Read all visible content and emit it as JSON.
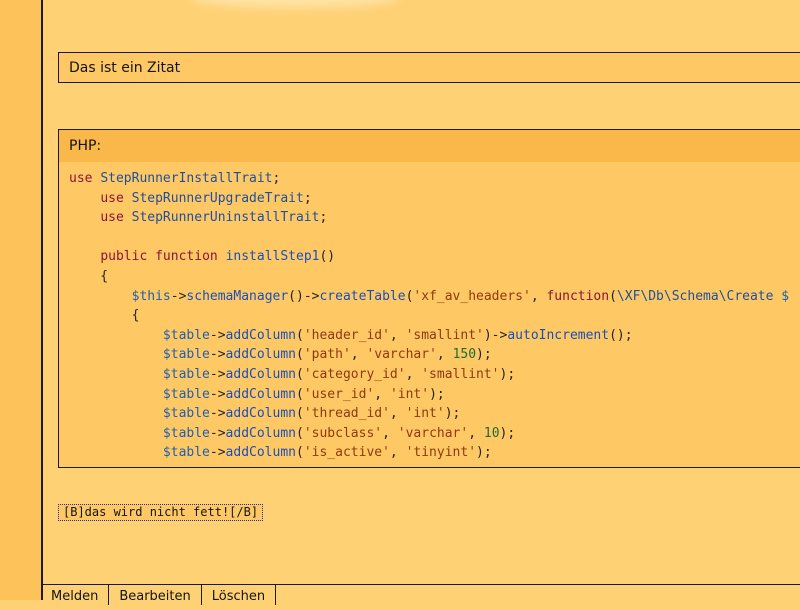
{
  "quote": {
    "text": "Das ist ein Zitat"
  },
  "code": {
    "header": "PHP:",
    "lines": [
      [
        [
          "kw",
          "use"
        ],
        [
          "t",
          " "
        ],
        [
          "cls",
          "StepRunnerInstallTrait"
        ],
        [
          "t",
          ";"
        ]
      ],
      [
        [
          "t",
          "    "
        ],
        [
          "kw",
          "use"
        ],
        [
          "t",
          " "
        ],
        [
          "cls",
          "StepRunnerUpgradeTrait"
        ],
        [
          "t",
          ";"
        ]
      ],
      [
        [
          "t",
          "    "
        ],
        [
          "kw",
          "use"
        ],
        [
          "t",
          " "
        ],
        [
          "cls",
          "StepRunnerUninstallTrait"
        ],
        [
          "t",
          ";"
        ]
      ],
      [],
      [
        [
          "t",
          "    "
        ],
        [
          "kw",
          "public"
        ],
        [
          "t",
          " "
        ],
        [
          "kw",
          "function"
        ],
        [
          "t",
          " "
        ],
        [
          "fn",
          "installStep1"
        ],
        [
          "t",
          "()"
        ]
      ],
      [
        [
          "t",
          "    {"
        ]
      ],
      [
        [
          "t",
          "        "
        ],
        [
          "var",
          "$this"
        ],
        [
          "t",
          "->"
        ],
        [
          "fn",
          "schemaManager"
        ],
        [
          "t",
          "()->"
        ],
        [
          "fn",
          "createTable"
        ],
        [
          "t",
          "("
        ],
        [
          "str",
          "'xf_av_headers'"
        ],
        [
          "t",
          ", "
        ],
        [
          "kw",
          "function"
        ],
        [
          "t",
          "("
        ],
        [
          "cls",
          "\\XF\\Db\\Schema\\Create"
        ],
        [
          "t",
          " "
        ],
        [
          "var",
          "$"
        ]
      ],
      [
        [
          "t",
          "        {"
        ]
      ],
      [
        [
          "t",
          "            "
        ],
        [
          "var",
          "$table"
        ],
        [
          "t",
          "->"
        ],
        [
          "fn",
          "addColumn"
        ],
        [
          "t",
          "("
        ],
        [
          "str",
          "'header_id'"
        ],
        [
          "t",
          ", "
        ],
        [
          "str",
          "'smallint'"
        ],
        [
          "t",
          ")->"
        ],
        [
          "fn",
          "autoIncrement"
        ],
        [
          "t",
          "();"
        ]
      ],
      [
        [
          "t",
          "            "
        ],
        [
          "var",
          "$table"
        ],
        [
          "t",
          "->"
        ],
        [
          "fn",
          "addColumn"
        ],
        [
          "t",
          "("
        ],
        [
          "str",
          "'path'"
        ],
        [
          "t",
          ", "
        ],
        [
          "str",
          "'varchar'"
        ],
        [
          "t",
          ", "
        ],
        [
          "num",
          "150"
        ],
        [
          "t",
          ");"
        ]
      ],
      [
        [
          "t",
          "            "
        ],
        [
          "var",
          "$table"
        ],
        [
          "t",
          "->"
        ],
        [
          "fn",
          "addColumn"
        ],
        [
          "t",
          "("
        ],
        [
          "str",
          "'category_id'"
        ],
        [
          "t",
          ", "
        ],
        [
          "str",
          "'smallint'"
        ],
        [
          "t",
          ");"
        ]
      ],
      [
        [
          "t",
          "            "
        ],
        [
          "var",
          "$table"
        ],
        [
          "t",
          "->"
        ],
        [
          "fn",
          "addColumn"
        ],
        [
          "t",
          "("
        ],
        [
          "str",
          "'user_id'"
        ],
        [
          "t",
          ", "
        ],
        [
          "str",
          "'int'"
        ],
        [
          "t",
          ");"
        ]
      ],
      [
        [
          "t",
          "            "
        ],
        [
          "var",
          "$table"
        ],
        [
          "t",
          "->"
        ],
        [
          "fn",
          "addColumn"
        ],
        [
          "t",
          "("
        ],
        [
          "str",
          "'thread_id'"
        ],
        [
          "t",
          ", "
        ],
        [
          "str",
          "'int'"
        ],
        [
          "t",
          ");"
        ]
      ],
      [
        [
          "t",
          "            "
        ],
        [
          "var",
          "$table"
        ],
        [
          "t",
          "->"
        ],
        [
          "fn",
          "addColumn"
        ],
        [
          "t",
          "("
        ],
        [
          "str",
          "'subclass'"
        ],
        [
          "t",
          ", "
        ],
        [
          "str",
          "'varchar'"
        ],
        [
          "t",
          ", "
        ],
        [
          "num",
          "10"
        ],
        [
          "t",
          ");"
        ]
      ],
      [
        [
          "t",
          "            "
        ],
        [
          "var",
          "$table"
        ],
        [
          "t",
          "->"
        ],
        [
          "fn",
          "addColumn"
        ],
        [
          "t",
          "("
        ],
        [
          "str",
          "'is_active'"
        ],
        [
          "t",
          ", "
        ],
        [
          "str",
          "'tinyint'"
        ],
        [
          "t",
          ");"
        ]
      ]
    ]
  },
  "bbcode": {
    "text": "[B]das wird nicht fett![/B]"
  },
  "actions": {
    "report": "Melden",
    "edit": "Bearbeiten",
    "delete": "Löschen"
  },
  "colors": {
    "background": "#fed174",
    "panel": "#fec865",
    "code_header": "#fab74a",
    "left_strip": "#fdc35a"
  }
}
